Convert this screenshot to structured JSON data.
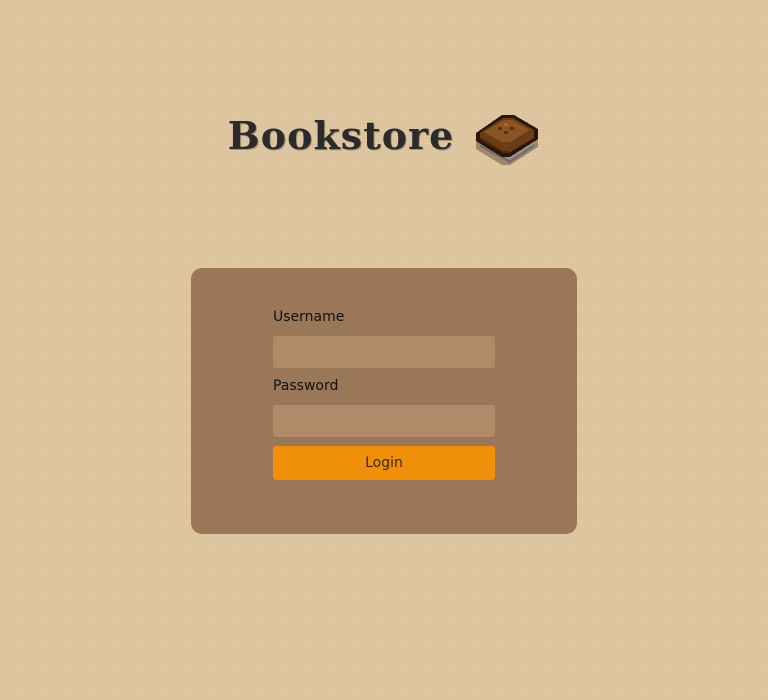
{
  "header": {
    "title": "Bookstore",
    "icon": "book-icon"
  },
  "login_form": {
    "username_label": "Username",
    "username_value": "",
    "password_label": "Password",
    "password_value": "",
    "login_button_label": "Login"
  },
  "colors": {
    "page_background": "#dfc8a1",
    "card_background": "#9a7758",
    "input_background": "#b18a6a",
    "button_background": "#f08f0a",
    "title_text": "#2b2b2b"
  }
}
